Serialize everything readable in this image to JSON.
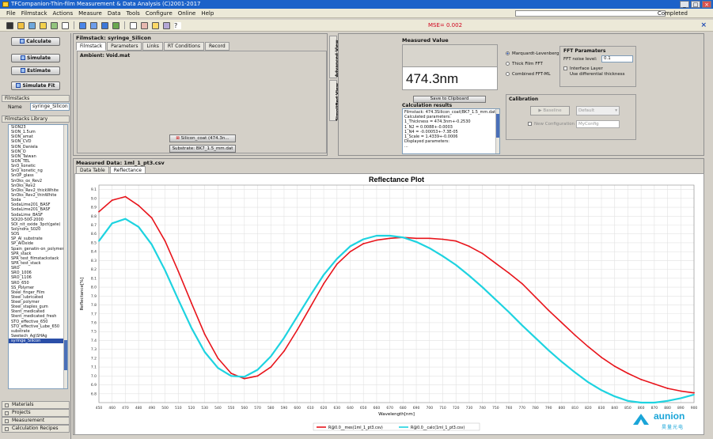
{
  "window": {
    "title": "TFCompanion-Thin-film Measurement & Data Analysis (C)2001-2017"
  },
  "menu": [
    "File",
    "Filmstack",
    "Actions",
    "Measure",
    "Data",
    "Tools",
    "Configure",
    "Online",
    "Help"
  ],
  "status": {
    "progress_label": "Completed",
    "progress_value": 1.0,
    "mse": "MSE= 0.002"
  },
  "left": {
    "buttons": {
      "calculate": "Calculate",
      "simulate": "Simulate",
      "estimate": "Estimate",
      "simulate_fit": "Simulate Fit"
    },
    "filmstacks_header": "Filmstacks",
    "name_label": "Name",
    "name_value": "syringe_Silicon",
    "library_header": "Filmstacks Library",
    "library": [
      "SiON23",
      "SiON_1.5um",
      "SiON_amat",
      "SiON_CVD",
      "SiON_Daniela",
      "SiON_O",
      "SiON_Taiwan",
      "SiON_TEL",
      "SnO_konetic",
      "SnO_konetic_ng",
      "SnOP_glass",
      "SnOks_ox_Rev2",
      "SnOks_Rev2",
      "SnOks_Rev2_thickWhite",
      "SnOks_Rev2_thinWhite",
      "Soda",
      "SodaLime201_BASF",
      "SodaLime201_BASF",
      "SodaLime_BASF",
      "SOI20-500-2000",
      "SOI_nit_oxide_3pct(gate)",
      "Solyndra_S020",
      "SOS",
      "SP_Al_substrate",
      "SP_AlOxide",
      "Spain_genatin-on_polymer",
      "SPR_stack",
      "SPR_test_filmstackstack",
      "SPR_test_stack",
      "SRO",
      "SRO_1006",
      "SRO_1106",
      "SRO_650",
      "SS_Polymer",
      "Steel_finger_Film",
      "Steel_lubricated",
      "Steel_polymer",
      "Steel_staples_gum",
      "Stent_medicated",
      "Stent_medicated_fresh",
      "STO_effective_650",
      "STO_effective_Lube_650",
      "substrate",
      "Swetech_Ag\\SHAg",
      "syringe_Silicon"
    ],
    "bottom_tabs": [
      "Materials",
      "Projects",
      "Measurement",
      "Calculation Recipes"
    ]
  },
  "filmstack": {
    "title": "Filmstack: syringe_Silicon",
    "tabs": [
      "Filmstack",
      "Parameters",
      "Links",
      "RT Conditions",
      "Record"
    ],
    "ambient": "Ambient: Void.mat",
    "layer": "Silicon_coat (474.3n...",
    "substrate": "Substrate: BK7_1.5_mm.dat",
    "vtabs": [
      "Advanced View",
      "Simplified View"
    ]
  },
  "measured": {
    "title": "Measured Value",
    "value": "474.3nm",
    "save_button": "Save to Clipboard",
    "calc_title": "Calculation results",
    "calc_lines": [
      "Filmstack: 474.3Silicon_coat(BK7_1.5_mm.dat)$hair",
      "Calculated parameters:",
      "1_Thickness = 474.3nm+-0.2530",
      "1_N2 = 0.0088+-0.0003",
      "1_N4 = -0.00053+-7.3E-05",
      "1_Scale = 1.4339+-0.0006",
      "Displayed parameters:",
      "..."
    ],
    "methods": [
      "Marquardt-Levenberg",
      "Thick Film FFT",
      "Combined FFT-ML"
    ],
    "fft_title": "FFT Paramaters",
    "fft_noise_label": "FFT noise level:",
    "fft_noise_value": "0.1",
    "interface_label": "Interface Layer",
    "use_diff_label": "Use differential thickness",
    "calib_title": "Calibration",
    "calib_btn": "Baseline",
    "calib_default": "Default",
    "new_config_label": "New Configuration",
    "config_name": "MyConfig"
  },
  "data_panel": {
    "title": "Measured Data: 1ml_1_pt3.csv",
    "tabs": [
      "Data Table",
      "Reflectance"
    ]
  },
  "chart_data": {
    "type": "line",
    "title": "Reflectance Plot",
    "xlabel": "Wavelength[nm]",
    "ylabel": "Reflectance[%]",
    "xlim": [
      450,
      900
    ],
    "ylim": [
      6.7,
      9.15
    ],
    "x_ticks": [
      450,
      460,
      470,
      480,
      490,
      500,
      510,
      520,
      530,
      540,
      550,
      560,
      570,
      580,
      590,
      600,
      610,
      620,
      630,
      640,
      650,
      660,
      670,
      680,
      690,
      700,
      710,
      720,
      730,
      740,
      750,
      760,
      770,
      780,
      790,
      800,
      810,
      820,
      830,
      840,
      850,
      860,
      870,
      880,
      890,
      900
    ],
    "y_ticks": [
      6.8,
      6.9,
      7.0,
      7.1,
      7.2,
      7.3,
      7.4,
      7.5,
      7.6,
      7.7,
      7.8,
      7.9,
      8.0,
      8.1,
      8.2,
      8.3,
      8.4,
      8.5,
      8.6,
      8.7,
      8.8,
      8.9,
      9.0,
      9.1
    ],
    "grid": true,
    "legend_position": "bottom",
    "series": [
      {
        "name": "R@0.0__mes(1ml_1_pt3.csv)",
        "color": "#e8141b",
        "x": [
          450,
          460,
          470,
          480,
          490,
          500,
          510,
          520,
          530,
          540,
          550,
          560,
          570,
          580,
          590,
          600,
          610,
          620,
          630,
          640,
          650,
          660,
          670,
          680,
          690,
          700,
          710,
          720,
          730,
          740,
          750,
          760,
          770,
          780,
          790,
          800,
          810,
          820,
          830,
          840,
          850,
          860,
          870,
          880,
          890,
          900
        ],
        "y": [
          8.85,
          8.98,
          9.02,
          8.92,
          8.78,
          8.52,
          8.18,
          7.82,
          7.47,
          7.2,
          7.03,
          6.97,
          7.0,
          7.1,
          7.28,
          7.52,
          7.78,
          8.04,
          8.26,
          8.4,
          8.49,
          8.53,
          8.55,
          8.56,
          8.55,
          8.55,
          8.54,
          8.52,
          8.46,
          8.38,
          8.27,
          8.16,
          8.04,
          7.89,
          7.74,
          7.6,
          7.46,
          7.33,
          7.21,
          7.11,
          7.03,
          6.96,
          6.91,
          6.86,
          6.83,
          6.81
        ]
      },
      {
        "name": "R@0.0__calc(1ml_1_pt3.csv)",
        "color": "#1ed3e0",
        "x": [
          450,
          460,
          470,
          480,
          490,
          500,
          510,
          520,
          530,
          540,
          550,
          560,
          570,
          580,
          590,
          600,
          610,
          620,
          630,
          640,
          650,
          660,
          670,
          680,
          690,
          700,
          710,
          720,
          730,
          740,
          750,
          760,
          770,
          780,
          790,
          800,
          810,
          820,
          830,
          840,
          850,
          860,
          870,
          880,
          890,
          900
        ],
        "y": [
          8.52,
          8.72,
          8.77,
          8.68,
          8.48,
          8.19,
          7.86,
          7.54,
          7.27,
          7.09,
          7.0,
          6.99,
          7.07,
          7.22,
          7.43,
          7.67,
          7.91,
          8.14,
          8.32,
          8.46,
          8.54,
          8.58,
          8.58,
          8.56,
          8.51,
          8.44,
          8.35,
          8.25,
          8.13,
          8.0,
          7.86,
          7.72,
          7.57,
          7.43,
          7.29,
          7.16,
          7.04,
          6.93,
          6.84,
          6.77,
          6.72,
          6.7,
          6.7,
          6.72,
          6.75,
          6.79
        ]
      }
    ]
  },
  "watermark": {
    "brand": "aunion",
    "sub": "昊量光电"
  }
}
